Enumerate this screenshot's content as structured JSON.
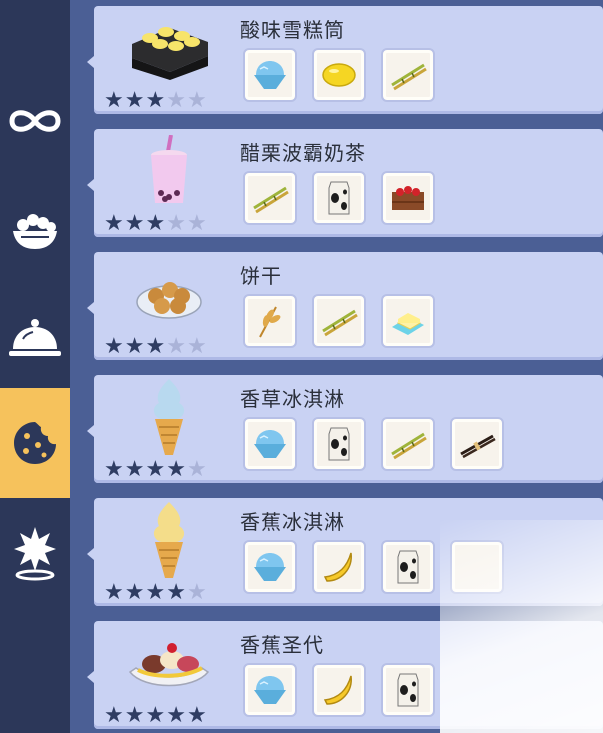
{
  "sidebar": {
    "items": [
      {
        "icon": "infinity-icon"
      },
      {
        "icon": "bowl-icon"
      },
      {
        "icon": "cloche-icon"
      },
      {
        "icon": "cookie-icon",
        "active": true
      },
      {
        "icon": "star-location-icon"
      }
    ]
  },
  "recipes": [
    {
      "name": "酸味雪糕筒",
      "stars": 3,
      "ingredients": [
        "ice-icon",
        "lemon-icon",
        "sugarcane-icon"
      ]
    },
    {
      "name": "醋栗波霸奶茶",
      "stars": 3,
      "ingredients": [
        "sugarcane-icon",
        "milk-carton-icon",
        "strawberry-crate-icon"
      ]
    },
    {
      "name": "饼干",
      "stars": 3,
      "ingredients": [
        "wheat-icon",
        "sugarcane-icon",
        "butter-icon"
      ]
    },
    {
      "name": "香草冰淇淋",
      "stars": 4,
      "ingredients": [
        "ice-icon",
        "milk-carton-icon",
        "sugarcane-icon",
        "vanilla-icon"
      ]
    },
    {
      "name": "香蕉冰淇淋",
      "stars": 4,
      "ingredients": [
        "ice-icon",
        "banana-icon",
        "milk-carton-icon",
        "empty"
      ]
    },
    {
      "name": "香蕉圣代",
      "stars": 5,
      "ingredients": [
        "ice-icon",
        "banana-icon",
        "milk-carton-icon"
      ]
    }
  ],
  "colors": {
    "sidebar_bg": "#2c3759",
    "active_tab": "#f6c25c",
    "card_bg": "#c9d2f3",
    "star_on": "#2f3d63",
    "star_off": "#aab3d8"
  }
}
